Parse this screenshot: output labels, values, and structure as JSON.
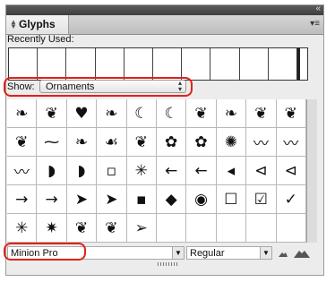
{
  "panel": {
    "tab_label": "Glyphs",
    "collapse_icon": "«",
    "menu_icon": "≡"
  },
  "recently_used": {
    "label": "Recently Used:",
    "cell_count": 10
  },
  "show": {
    "label": "Show:",
    "value": "Ornaments"
  },
  "glyphs": [
    [
      "❧",
      "❦",
      "♥",
      "❧",
      "☾",
      "☾",
      "❦",
      "❧",
      "❦",
      "❦"
    ],
    [
      "❦",
      "⁓",
      "❧",
      "☙",
      "❦",
      "✿",
      "✿",
      "✺",
      "〰",
      "〰"
    ],
    [
      "〰",
      "◗",
      "◗",
      "▫",
      "✳",
      "←",
      "←",
      "◂",
      "⊲",
      "⊲"
    ],
    [
      "→",
      "→",
      "➤",
      "➤",
      "▪",
      "◆",
      "◉",
      "☐",
      "☑",
      "✓"
    ],
    [
      "✳",
      "✷",
      "❦",
      "❦",
      "➢",
      "",
      "",
      "",
      "",
      ""
    ]
  ],
  "font": {
    "family": "Minion Pro",
    "style": "Regular"
  },
  "zoom": {
    "out_icon": "mountain-small-icon",
    "in_icon": "mountain-large-icon"
  },
  "colors": {
    "highlight_ring": "#e0211a"
  }
}
